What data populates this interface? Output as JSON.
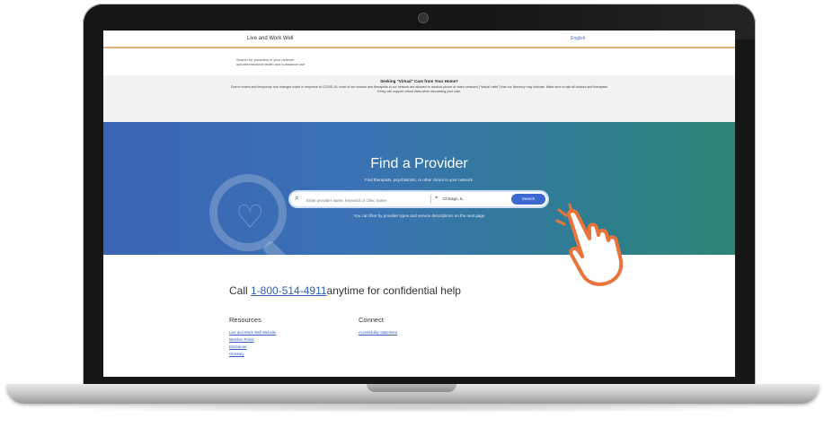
{
  "header": {
    "brand": "Live and Work Well",
    "language": "English"
  },
  "search_for": {
    "line1": "Search for providers in your network",
    "line2": "optumbehavioral health and substance use"
  },
  "notice": {
    "title": "Seeking \"Virtual\" Care from Your Home?",
    "body": "Due to recent and temporary rule changes made in response to COVID-19, most of our doctors and therapists in our network are allowed to conduct phone or video sessions (\"virtual visits\") that our directory may indicate. Make sure to ask all doctors and therapists if they can support virtual visits when discussing your care."
  },
  "hero": {
    "title": "Find a Provider",
    "subtitle": "Find therapists, psychiatrists, or other clinics in your network.",
    "search_placeholder": "Enter provider name, keyword or clinic name",
    "location": "Chicago, IL",
    "search_button": "Search",
    "note": "You can filter by provider types and service descriptions on the next page"
  },
  "call": {
    "prefix": "Call",
    "number": "1-800-514-4911",
    "suffix": "anytime for confidential help"
  },
  "resources": {
    "heading": "Resources",
    "links": [
      "Live and Work Well Website",
      "Member Portal",
      "Disclaimer",
      "Glossary"
    ]
  },
  "connect": {
    "heading": "Connect",
    "links": [
      "Accessibility Statement"
    ]
  },
  "colors": {
    "hero_start": "#3b64b5",
    "hero_end": "#2c8575",
    "accent_button": "#3c68d0",
    "link": "#2f5fb8",
    "hand_outline": "#e8743b"
  }
}
